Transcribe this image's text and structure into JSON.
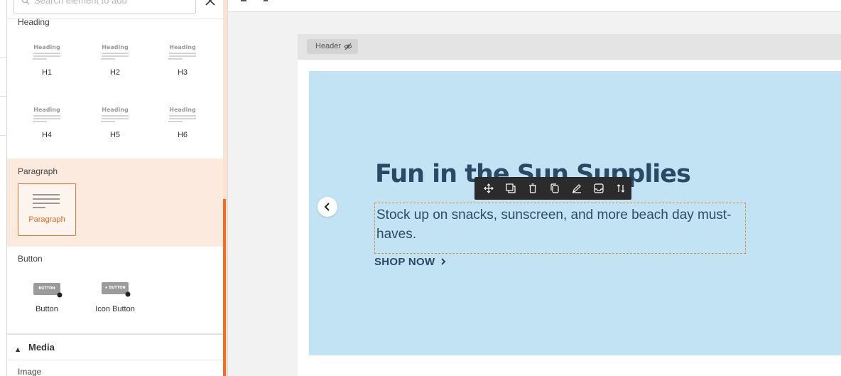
{
  "sidebar": {
    "search": {
      "placeholder": "Search element to add"
    },
    "heading_section": {
      "title": "Heading",
      "items": [
        {
          "label": "H1",
          "thumb_text": "Heading"
        },
        {
          "label": "H2",
          "thumb_text": "Heading"
        },
        {
          "label": "H3",
          "thumb_text": "Heading"
        },
        {
          "label": "H4",
          "thumb_text": "Heading"
        },
        {
          "label": "H5",
          "thumb_text": "Heading"
        },
        {
          "label": "H6",
          "thumb_text": "Heading"
        }
      ]
    },
    "paragraph_section": {
      "title": "Paragraph",
      "item_label": "Paragraph"
    },
    "button_section": {
      "title": "Button",
      "items": [
        {
          "label": "Button",
          "thumb_text": "BUTTON"
        },
        {
          "label": "Icon Button",
          "thumb_text": "★ BUTTON"
        }
      ]
    },
    "media_section": {
      "title": "Media",
      "first_item": "Image"
    }
  },
  "canvas": {
    "header_pill": "Header",
    "hero": {
      "title": "Fun in the Sun Supplies",
      "text": "Stock up on snacks, sunscreen, and more beach day must-haves.",
      "cta": "SHOP NOW"
    },
    "toolbar_icons": [
      "move-icon",
      "resize-icon",
      "delete-icon",
      "duplicate-icon",
      "edit-icon",
      "save-icon",
      "reorder-icon"
    ]
  },
  "colors": {
    "accent": "#f36c21",
    "hero_bg": "#c1e3f4",
    "hero_text": "#2a4966",
    "selected_band": "#fdeadf"
  }
}
